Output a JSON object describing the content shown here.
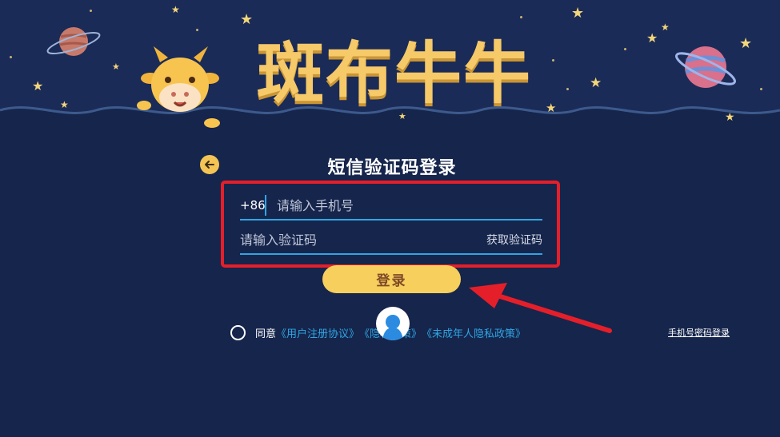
{
  "brand": {
    "title": "斑布牛牛"
  },
  "login": {
    "title": "短信验证码登录",
    "phone_prefix": "+86",
    "phone_placeholder": "请输入手机号",
    "code_placeholder": "请输入验证码",
    "get_code_label": "获取验证码",
    "submit_label": "登录"
  },
  "agreement": {
    "prefix": "同意",
    "user_agreement": "《用户注册协议》",
    "privacy_policy": "《隐私政策》",
    "minor_privacy_policy": "《未成年人隐私政策》"
  },
  "alt_login": {
    "label": "手机号密码登录"
  },
  "colors": {
    "background": "#16254c",
    "accent_yellow": "#f6cf5c",
    "link_blue": "#2fa6e3",
    "highlight_red": "#e51f2a"
  },
  "icons": [
    "back-arrow-icon",
    "mascot-cow-icon",
    "planet-icon",
    "star-icon",
    "person-icon",
    "red-arrow-icon"
  ]
}
